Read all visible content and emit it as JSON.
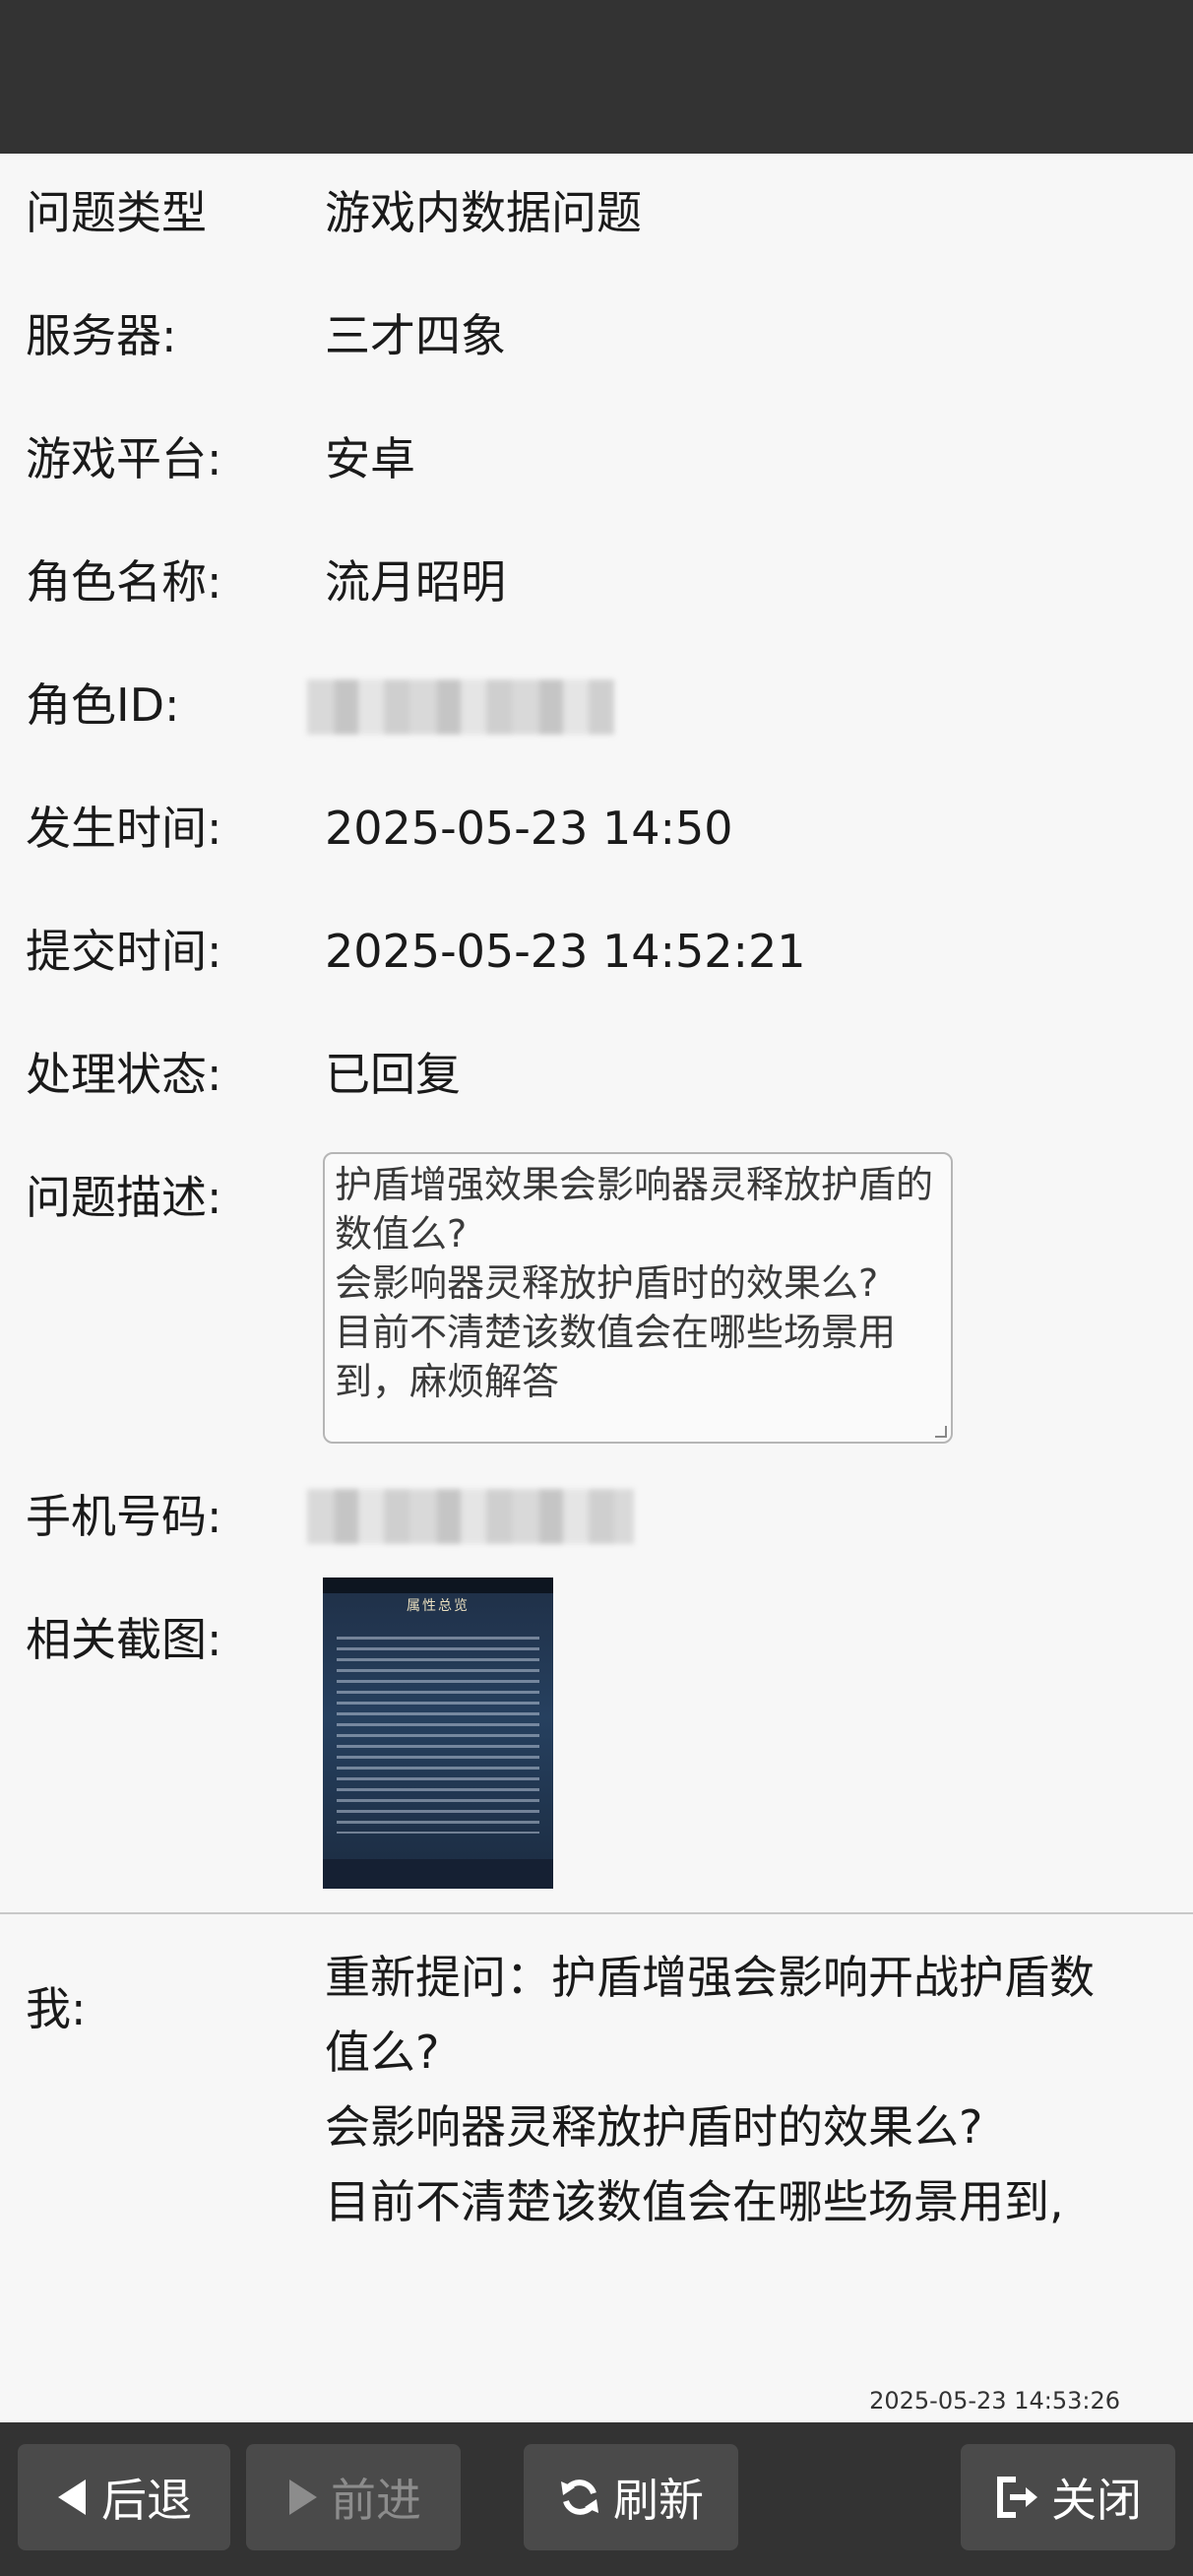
{
  "fields": [
    {
      "label": "问题类型",
      "value": "游戏内数据问题"
    },
    {
      "label": "服务器:",
      "value": "三才四象"
    },
    {
      "label": "游戏平台:",
      "value": "安卓"
    },
    {
      "label": "角色名称:",
      "value": "流月昭明"
    },
    {
      "label": "角色ID:",
      "value": ""
    },
    {
      "label": "发生时间:",
      "value": "2025-05-23 14:50"
    },
    {
      "label": "提交时间:",
      "value": "2025-05-23 14:52:21"
    },
    {
      "label": "处理状态:",
      "value": "已回复"
    }
  ],
  "description": {
    "label": "问题描述:",
    "text": "护盾增强效果会影响器灵释放护盾的数值么?\n会影响器灵释放护盾时的效果么?\n目前不清楚该数值会在哪些场景用到，麻烦解答"
  },
  "phone": {
    "label": "手机号码:",
    "value": ""
  },
  "screenshot": {
    "label": "相关截图:",
    "title": "属性总览"
  },
  "reply": {
    "sender": "我:",
    "text": "重新提问：护盾增强会影响开战护盾数值么?\n会影响器灵释放护盾时的效果么?\n目前不清楚该数值会在哪些场景用到,",
    "time": "2025-05-23 14:53:26"
  },
  "toolbar": {
    "back": "后退",
    "forward": "前进",
    "refresh": "刷新",
    "close": "关闭"
  },
  "colors": {
    "bar": "#333333",
    "button": "#4a4a4a",
    "background": "#f7f7f7"
  }
}
